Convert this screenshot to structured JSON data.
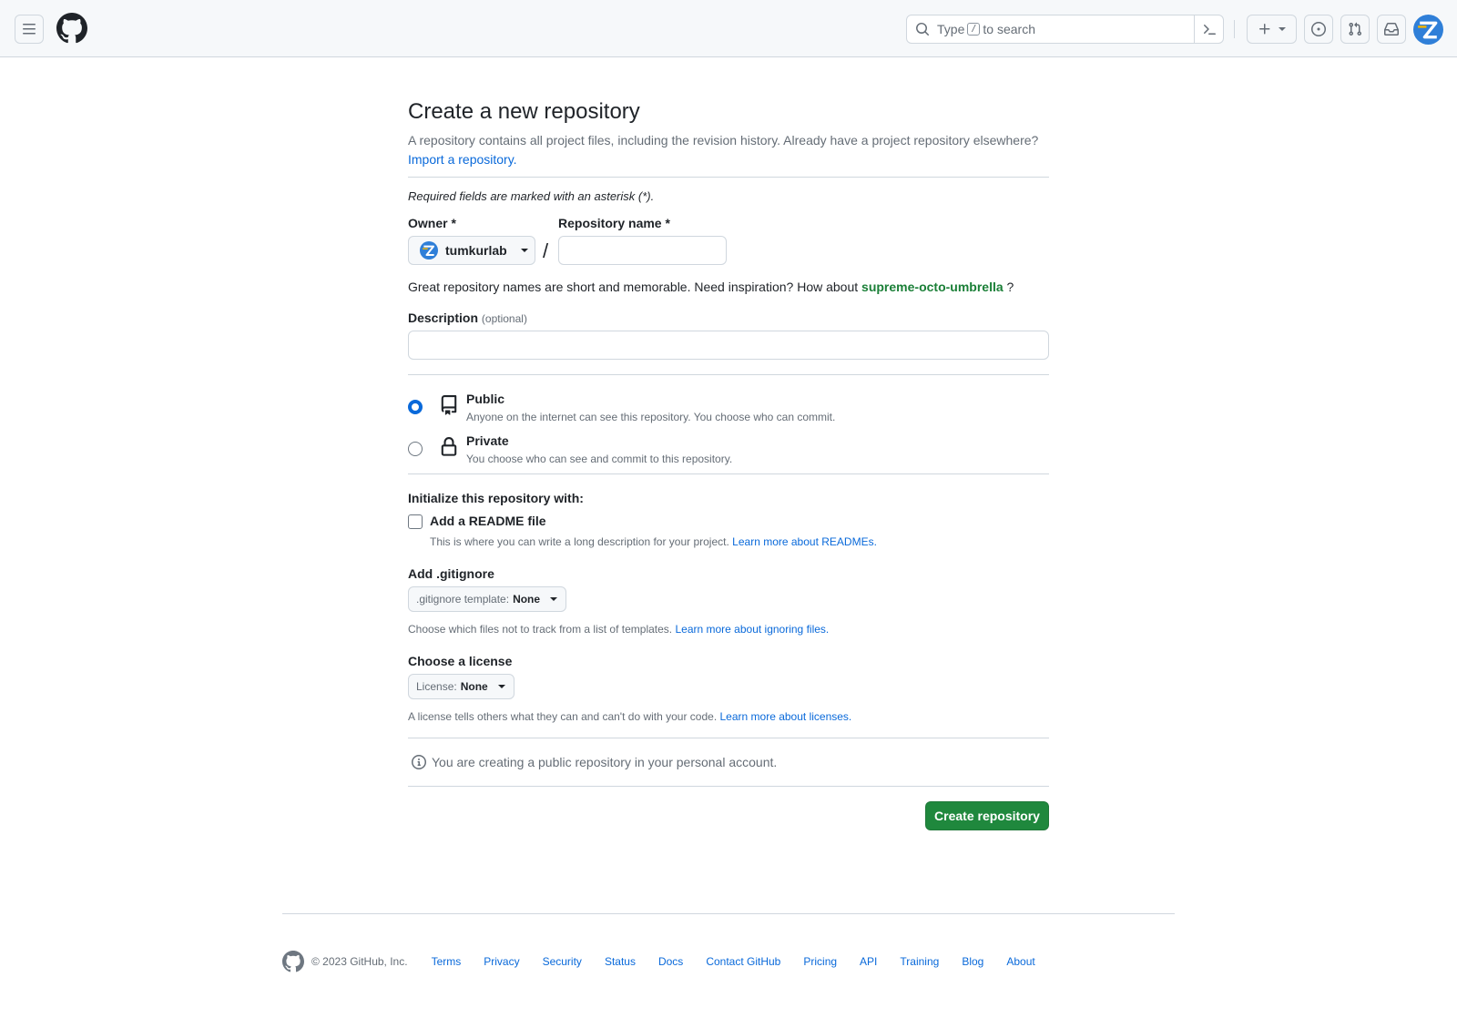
{
  "header": {
    "search_prefix": "Type",
    "search_key": "/",
    "search_suffix": "to search"
  },
  "page": {
    "title": "Create a new repository",
    "subtitle": "A repository contains all project files, including the revision history. Already have a project repository elsewhere?",
    "import_link": "Import a repository.",
    "required_note": "Required fields are marked with an asterisk (*)."
  },
  "owner": {
    "label": "Owner *",
    "value": "tumkurlab"
  },
  "repo": {
    "label": "Repository name *",
    "value": ""
  },
  "suggestion": {
    "text": "Great repository names are short and memorable. Need inspiration? How about",
    "name": "supreme-octo-umbrella",
    "end": "?"
  },
  "description": {
    "label": "Description",
    "optional": "(optional)",
    "value": ""
  },
  "visibility": {
    "selected": "public",
    "public_title": "Public",
    "public_desc": "Anyone on the internet can see this repository. You choose who can commit.",
    "private_title": "Private",
    "private_desc": "You choose who can see and commit to this repository."
  },
  "init": {
    "heading": "Initialize this repository with:",
    "readme_label": "Add a README file",
    "readme_checked": false,
    "readme_desc": "This is where you can write a long description for your project.",
    "readme_link": "Learn more about READMEs."
  },
  "gitignore": {
    "heading": "Add .gitignore",
    "prefix": ".gitignore template:",
    "value": "None",
    "note": "Choose which files not to track from a list of templates.",
    "link": "Learn more about ignoring files."
  },
  "license": {
    "heading": "Choose a license",
    "prefix": "License:",
    "value": "None",
    "note": "A license tells others what they can and can't do with your code.",
    "link": "Learn more about licenses."
  },
  "info": "You are creating a public repository in your personal account.",
  "create_button": "Create repository",
  "footer": {
    "copyright": "© 2023 GitHub, Inc.",
    "links": [
      "Terms",
      "Privacy",
      "Security",
      "Status",
      "Docs",
      "Contact GitHub",
      "Pricing",
      "API",
      "Training",
      "Blog",
      "About"
    ]
  },
  "colors": {
    "accent": "#0969da",
    "primary_button": "#1f883d",
    "suggestion_green": "#1a7f37"
  }
}
